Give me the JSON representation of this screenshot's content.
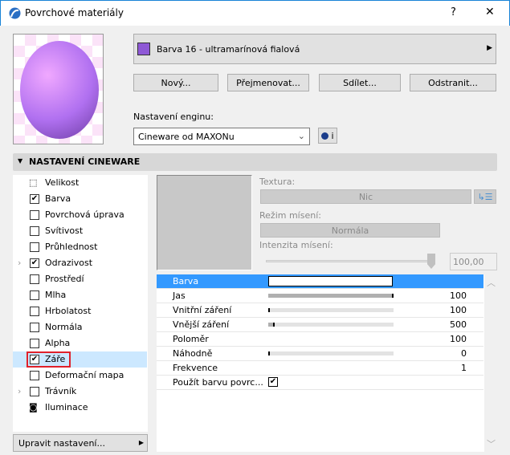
{
  "window": {
    "title": "Povrchové materiály",
    "help": "?",
    "close": "✕"
  },
  "material": {
    "name": "Barva 16 - ultramarínová fialová",
    "swatch": "#8e58d6"
  },
  "buttons": {
    "new": "Nový...",
    "rename": "Přejmenovat...",
    "share": "Sdílet...",
    "delete": "Odstranit..."
  },
  "engine": {
    "label": "Nastavení enginu:",
    "value": "Cineware od MAXONu",
    "info": "i"
  },
  "section": {
    "title": "NASTAVENÍ CINEWARE"
  },
  "channels": [
    {
      "label": "Velikost",
      "type": "icon",
      "checked": false
    },
    {
      "label": "Barva",
      "checked": true
    },
    {
      "label": "Povrchová úprava",
      "checked": false
    },
    {
      "label": "Svítivost",
      "checked": false
    },
    {
      "label": "Průhlednost",
      "checked": false
    },
    {
      "label": "Odrazivost",
      "checked": true,
      "expandable": true
    },
    {
      "label": "Prostředí",
      "checked": false
    },
    {
      "label": "Mlha",
      "checked": false
    },
    {
      "label": "Hrbolatost",
      "checked": false
    },
    {
      "label": "Normála",
      "checked": false
    },
    {
      "label": "Alpha",
      "checked": false
    },
    {
      "label": "Záře",
      "checked": true,
      "selected": true
    },
    {
      "label": "Deformační mapa",
      "checked": false
    },
    {
      "label": "Trávník",
      "checked": false,
      "expandable": true
    },
    {
      "label": "Iluminace",
      "type": "icon",
      "checked": false
    }
  ],
  "edit_settings": "Upravit nastavení...",
  "texture": {
    "label": "Textura:",
    "value": "Nic",
    "blend_label": "Režim mísení:",
    "blend_value": "Normála",
    "intensity_label": "Intenzita mísení:",
    "intensity_value": "100,00",
    "intensity_fraction": 1.0
  },
  "params": [
    {
      "name": "Barva",
      "type": "color",
      "selected": true
    },
    {
      "name": "Jas",
      "value": "100",
      "fraction": 1.0
    },
    {
      "name": "Vnitřní záření",
      "value": "100",
      "fraction": 0.0
    },
    {
      "name": "Vnější záření",
      "value": "500",
      "fraction": 0.05
    },
    {
      "name": "Poloměr",
      "value": "100"
    },
    {
      "name": "Náhodně",
      "value": "0",
      "fraction": 0.0
    },
    {
      "name": "Frekvence",
      "value": "1"
    },
    {
      "name": "Použít barvu povrc...",
      "type": "checkbox",
      "checked": true
    }
  ]
}
